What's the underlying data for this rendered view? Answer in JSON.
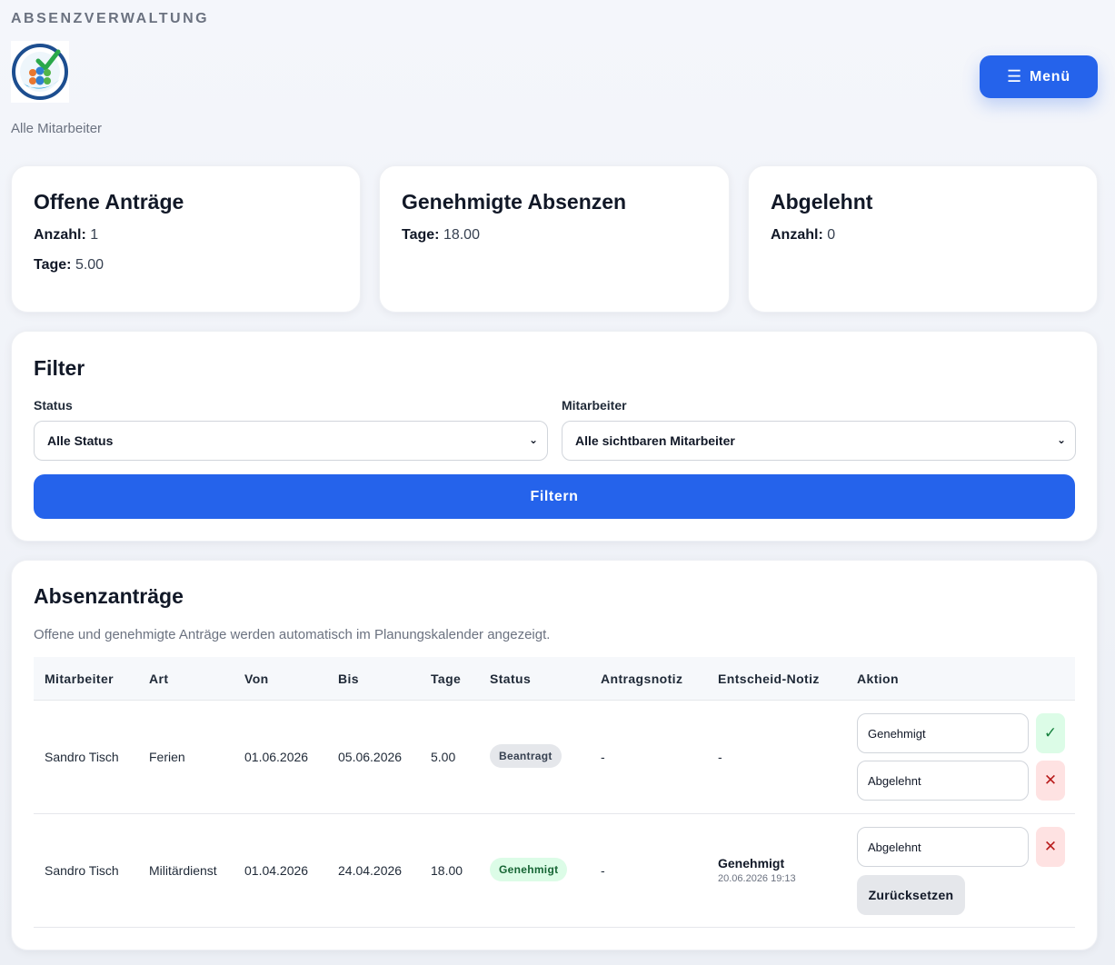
{
  "app": {
    "title": "ABSENZVERWALTUNG",
    "subtitle": "Alle Mitarbeiter",
    "menu_label": "Menü"
  },
  "stats": [
    {
      "title": "Offene Anträge",
      "lines": [
        {
          "label": "Anzahl:",
          "value": "1"
        },
        {
          "label": "Tage:",
          "value": "5.00"
        }
      ]
    },
    {
      "title": "Genehmigte Absenzen",
      "lines": [
        {
          "label": "Tage:",
          "value": "18.00"
        }
      ]
    },
    {
      "title": "Abgelehnt",
      "lines": [
        {
          "label": "Anzahl:",
          "value": "0"
        }
      ]
    }
  ],
  "filter": {
    "title": "Filter",
    "status_label": "Status",
    "status_value": "Alle Status",
    "employee_label": "Mitarbeiter",
    "employee_value": "Alle sichtbaren Mitarbeiter",
    "button_label": "Filtern"
  },
  "requests": {
    "title": "Absenzanträge",
    "hint": "Offene und genehmigte Anträge werden automatisch im Planungskalender angezeigt.",
    "columns": [
      "Mitarbeiter",
      "Art",
      "Von",
      "Bis",
      "Tage",
      "Status",
      "Antragsnotiz",
      "Entscheid-Notiz",
      "Aktion"
    ],
    "rows": [
      {
        "employee": "Sandro Tisch",
        "type": "Ferien",
        "from": "01.06.2026",
        "to": "05.06.2026",
        "days": "5.00",
        "status": "Beantragt",
        "request_note": "-",
        "decision_note": "-",
        "action_inputs": [
          "Genehmigt",
          "Abgelehnt"
        ]
      },
      {
        "employee": "Sandro Tisch",
        "type": "Militärdienst",
        "from": "01.04.2026",
        "to": "24.04.2026",
        "days": "18.00",
        "status": "Genehmigt",
        "request_note": "-",
        "decision_title": "Genehmigt",
        "decision_time": "20.06.2026 19:13",
        "action_inputs": [
          "Abgelehnt"
        ],
        "reset_label": "Zurücksetzen"
      }
    ]
  },
  "icons": {
    "approve": "✓",
    "reject": "✕",
    "menu": "☰",
    "chevron": "⌄"
  },
  "colors": {
    "accent": "#2563eb",
    "approve_bg": "#dcfce7",
    "reject_bg": "#fee2e2"
  }
}
